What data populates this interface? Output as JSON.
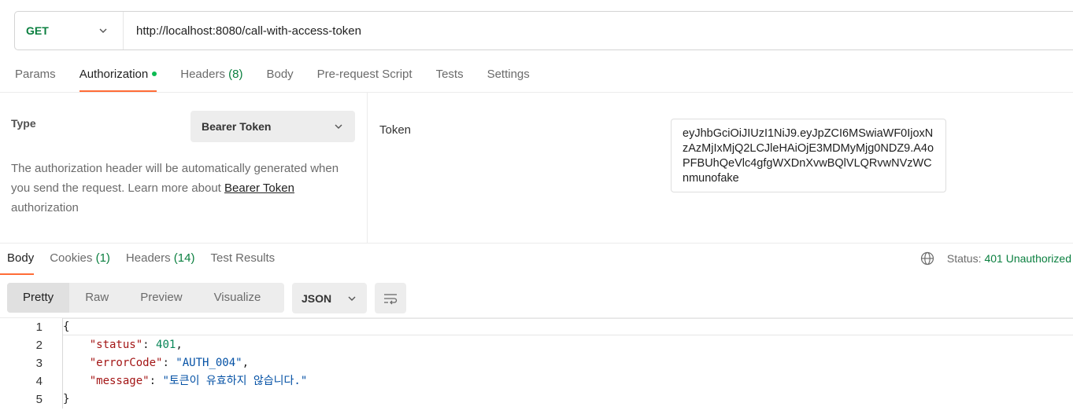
{
  "request": {
    "method": "GET",
    "url": "http://localhost:8080/call-with-access-token"
  },
  "request_tabs": [
    {
      "label": "Params"
    },
    {
      "label": "Authorization"
    },
    {
      "label": "Headers",
      "count": "(8)"
    },
    {
      "label": "Body"
    },
    {
      "label": "Pre-request Script"
    },
    {
      "label": "Tests"
    },
    {
      "label": "Settings"
    }
  ],
  "auth": {
    "type_label": "Type",
    "type_value": "Bearer Token",
    "desc_before": "The authorization header will be automatically generated when you send the request. Learn more about ",
    "desc_link": "Bearer Token",
    "desc_after": " authorization",
    "token_label": "Token",
    "token_value": "eyJhbGciOiJIUzI1NiJ9.eyJpZCI6MSwiaWF0IjoxNzAzMjIxMjQ2LCJleHAiOjE3MDMyMjg0NDZ9.A4oPFBUhQeVlc4gfgWXDnXvwBQlVLQRvwNVzWCnmunofake"
  },
  "response_tabs": [
    {
      "label": "Body"
    },
    {
      "label": "Cookies",
      "count": "(1)"
    },
    {
      "label": "Headers",
      "count": "(14)"
    },
    {
      "label": "Test Results"
    }
  ],
  "status": {
    "label": "Status:",
    "value": "401 Unauthorized"
  },
  "view_modes": [
    "Pretty",
    "Raw",
    "Preview",
    "Visualize"
  ],
  "format": "JSON",
  "code": {
    "line_numbers": [
      "1",
      "2",
      "3",
      "4",
      "5"
    ],
    "open": "{",
    "close": "}",
    "fields": [
      {
        "key": "\"status\"",
        "value": "401",
        "comma": ","
      },
      {
        "key": "\"errorCode\"",
        "value": "\"AUTH_004\"",
        "comma": ","
      },
      {
        "key": "\"message\"",
        "value": "\"토큰이 유효하지 않습니다.\"",
        "comma": ""
      }
    ]
  }
}
